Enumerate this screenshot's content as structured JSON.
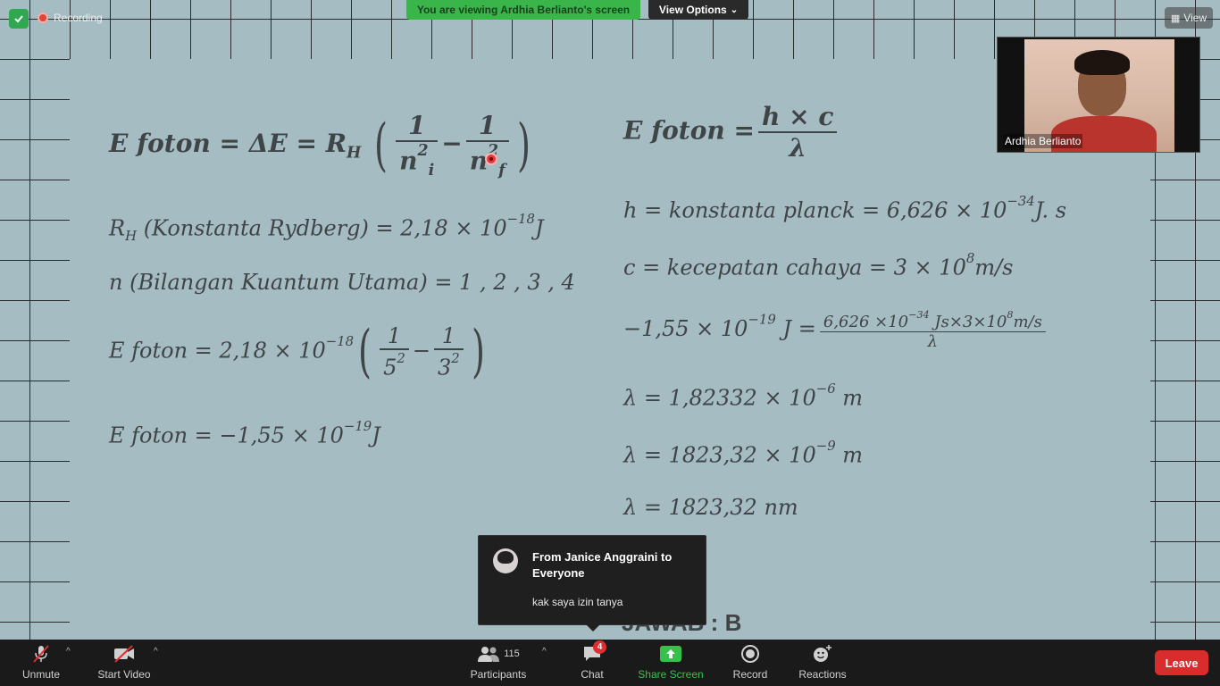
{
  "top_bar": {
    "recording_label": "Recording",
    "viewing_banner": "You are viewing Ardhia Berlianto's screen",
    "view_options_label": "View Options",
    "view_label": "View"
  },
  "video_thumb": {
    "participant_name": "Ardhia Berlianto"
  },
  "slide": {
    "left": {
      "eq1_lhs": "E foton = ΔE = R",
      "eq1_sub": "H",
      "eq1_frac1_num": "1",
      "eq1_frac1_den": "n",
      "eq1_frac1_den_sup": "2",
      "eq1_frac1_den_sub": "i",
      "eq1_minus": "−",
      "eq1_frac2_num": "1",
      "eq1_frac2_den": "n",
      "eq1_frac2_den_sup": "2",
      "eq1_frac2_den_sub": "f",
      "eq2_a": "R",
      "eq2_sub": "H",
      "eq2_b": " (Konstanta Rydberg) = 2,18 × 10",
      "eq2_sup": "−18",
      "eq2_c": "J",
      "eq3": "n (Bilangan Kuantum Utama) = 1 , 2 , 3 , 4",
      "eq4_a": "E foton = 2,18 × 10",
      "eq4_sup": "−18",
      "eq4_frac1_num": "1",
      "eq4_frac1_den": "5",
      "eq4_frac1_den_sup": "2",
      "eq4_minus": "−",
      "eq4_frac2_num": "1",
      "eq4_frac2_den": "3",
      "eq4_frac2_den_sup": "2",
      "eq5_a": "E foton = −1,55 × 10",
      "eq5_sup": "−19",
      "eq5_b": "J"
    },
    "right": {
      "eqA_lhs": "E foton =",
      "eqA_num": "h × c",
      "eqA_den": "λ",
      "eqB_a": "h = konstanta planck = 6,626  × 10",
      "eqB_sup": "−34",
      "eqB_b": "J. s",
      "eqC_a": "c = kecepatan cahaya = 3 × 10",
      "eqC_sup": "8",
      "eqC_b": "m/s",
      "eqD_a": "−1,55 × 10",
      "eqD_sup": "−19",
      "eqD_b": " J =",
      "eqD_num_a": "6,626 ×10",
      "eqD_num_sup1": "−34",
      "eqD_num_b": " Js×3×10",
      "eqD_num_sup2": "8",
      "eqD_num_c": "m/s",
      "eqD_den": "λ",
      "eqE_a": "λ  = 1,82332  × 10",
      "eqE_sup": "−6",
      "eqE_b": " m",
      "eqF_a": "λ  = 1823,32  × 10",
      "eqF_sup": "−9",
      "eqF_b": " m",
      "eqG": "λ  = 1823,32 nm",
      "answer": "JAWAB : B"
    }
  },
  "chat_notification": {
    "from": "From Janice Anggraini to Everyone",
    "message": "kak saya izin tanya"
  },
  "toolbar": {
    "unmute_label": "Unmute",
    "start_video_label": "Start Video",
    "participants_label": "Participants",
    "participants_count": "115",
    "chat_label": "Chat",
    "chat_badge": "4",
    "share_screen_label": "Share Screen",
    "record_label": "Record",
    "reactions_label": "Reactions",
    "leave_label": "Leave"
  },
  "colors": {
    "banner_green": "#3ab54a",
    "leave_red": "#d92d2d",
    "slide_bg": "#a6bcc3",
    "share_green": "#35c24a"
  }
}
